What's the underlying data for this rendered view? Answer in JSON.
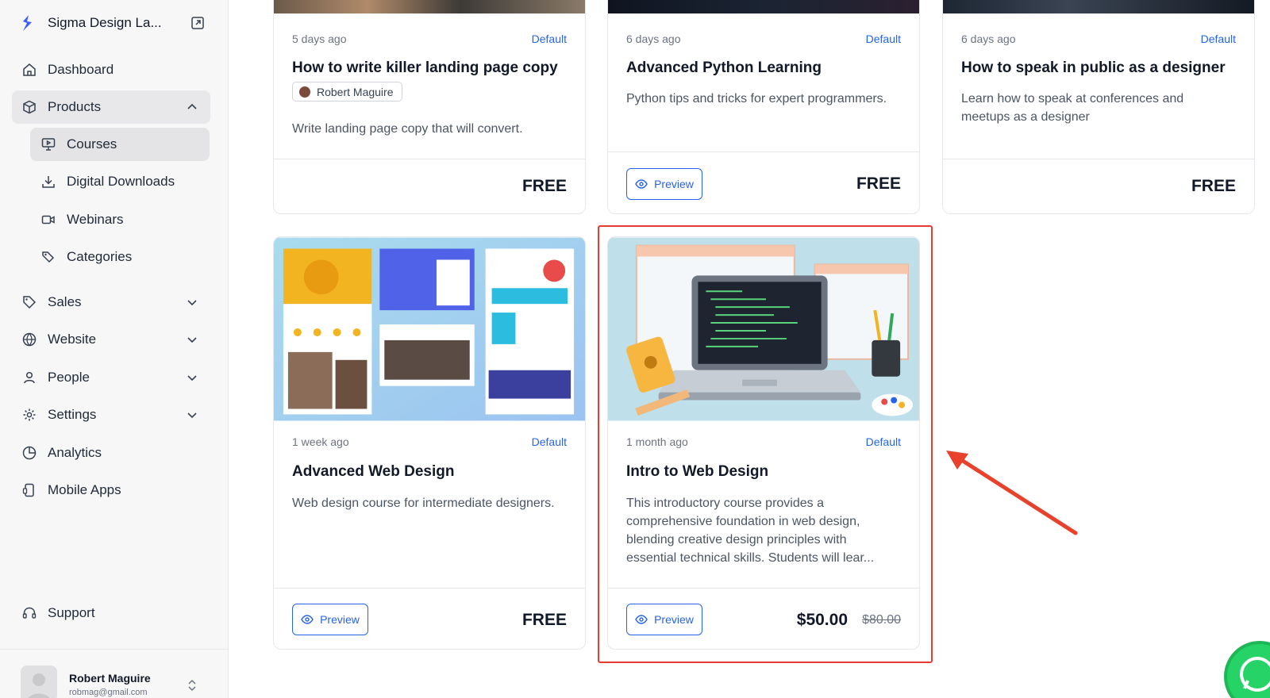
{
  "sidebar": {
    "brand": "Sigma Design La...",
    "items": {
      "dashboard": "Dashboard",
      "products": "Products",
      "courses": "Courses",
      "downloads": "Digital Downloads",
      "webinars": "Webinars",
      "categories": "Categories",
      "sales": "Sales",
      "website": "Website",
      "people": "People",
      "settings": "Settings",
      "analytics": "Analytics",
      "mobile": "Mobile Apps",
      "support": "Support"
    },
    "user": {
      "name": "Robert Maguire",
      "email": "robmag@gmail.com"
    }
  },
  "cards": [
    {
      "time": "5 days ago",
      "tag": "Default",
      "title": "How to write killer landing page copy",
      "author": "Robert Maguire",
      "desc": "Write landing page copy that will convert.",
      "price": "FREE"
    },
    {
      "time": "6 days ago",
      "tag": "Default",
      "title": "Advanced Python Learning",
      "desc": "Python tips and tricks for expert programmers.",
      "price": "FREE",
      "button": "Preview"
    },
    {
      "time": "6 days ago",
      "tag": "Default",
      "title": "How to speak in public as a designer",
      "desc": "Learn how to speak at conferences and meetups as a designer",
      "price": "FREE"
    },
    {
      "time": "1 week ago",
      "tag": "Default",
      "title": "Advanced Web Design",
      "desc": "Web design course for intermediate designers.",
      "price": "FREE",
      "button": "Preview"
    },
    {
      "time": "1 month ago",
      "tag": "Default",
      "title": "Intro to Web Design",
      "desc": "This introductory course provides a comprehensive foundation in web design, blending creative design principles with essential technical skills. Students will lear...",
      "price": "$50.00",
      "old_price": "$80.00",
      "button": "Preview"
    }
  ],
  "colors": {
    "accent": "#2563eb",
    "highlight": "#e53e30"
  }
}
